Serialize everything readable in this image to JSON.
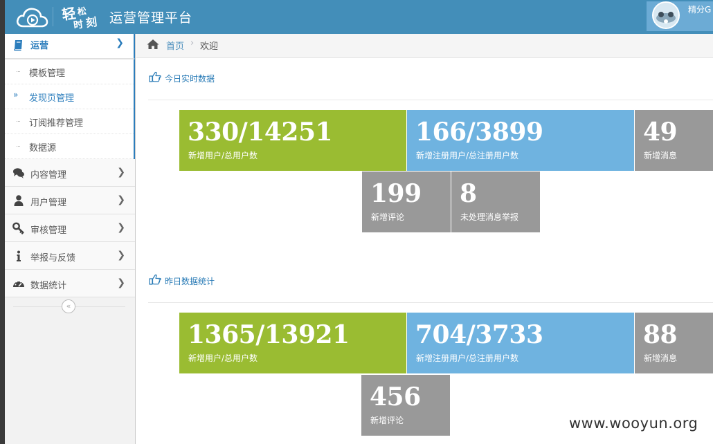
{
  "header": {
    "brand_title": "运营管理平台",
    "brand_mark_text": "轻松时刻",
    "user_name": "精分G"
  },
  "sidebar": {
    "items": [
      {
        "label": "运营",
        "icon": "book-icon",
        "active": true,
        "children": [
          {
            "label": "模板管理"
          },
          {
            "label": "发现页管理",
            "active": true
          },
          {
            "label": "订阅推荐管理"
          },
          {
            "label": "数据源"
          }
        ]
      },
      {
        "label": "内容管理",
        "icon": "comments-icon"
      },
      {
        "label": "用户管理",
        "icon": "user-icon"
      },
      {
        "label": "审核管理",
        "icon": "key-icon"
      },
      {
        "label": "举报与反馈",
        "icon": "info-icon"
      },
      {
        "label": "数据统计",
        "icon": "dashboard-icon"
      }
    ],
    "collapse_glyph": "«"
  },
  "breadcrumb": {
    "home": "首页",
    "separator": "›",
    "current": "欢迎"
  },
  "today": {
    "title": "今日实时数据",
    "tiles": [
      {
        "value": "330/14251",
        "caption": "新增用户/总用户数",
        "color": "#9abc32"
      },
      {
        "value": "166/3899",
        "caption": "新增注册用户/总注册用户数",
        "color": "#6fb3e0"
      },
      {
        "value": "49",
        "caption": "新增消息",
        "color": "#999999"
      },
      {
        "value": "199",
        "caption": "新增评论",
        "color": "#999999"
      },
      {
        "value": "8",
        "caption": "未处理消息举报",
        "color": "#999999"
      }
    ]
  },
  "yesterday": {
    "title": "昨日数据统计",
    "tiles": [
      {
        "value": "1365/13921",
        "caption": "新增用户/总用户数",
        "color": "#9abc32"
      },
      {
        "value": "704/3733",
        "caption": "新增注册用户/总注册用户数",
        "color": "#6fb3e0"
      },
      {
        "value": "88",
        "caption": "新增消息",
        "color": "#999999"
      },
      {
        "value": "456",
        "caption": "新增评论",
        "color": "#999999"
      }
    ]
  },
  "watermark": "www.wooyun.org"
}
